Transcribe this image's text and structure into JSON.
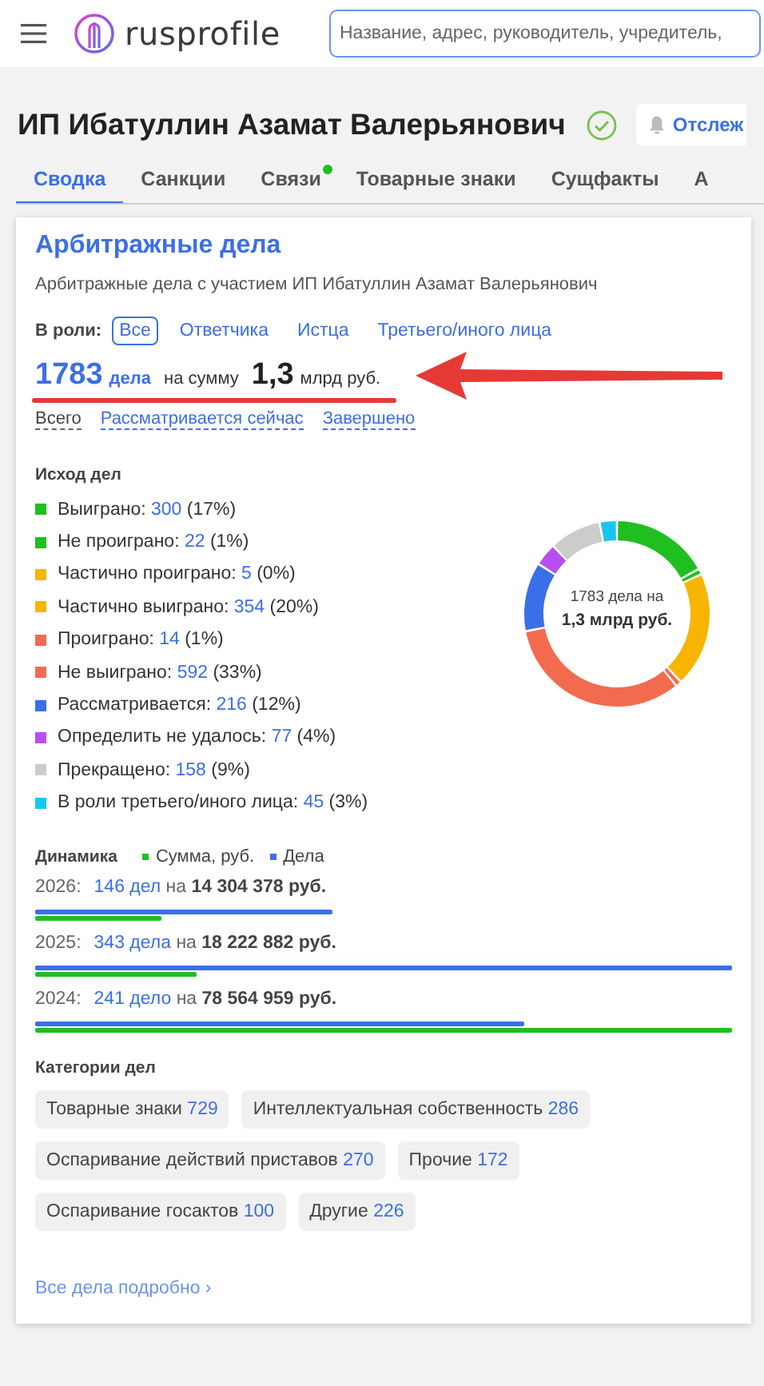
{
  "header": {
    "logo": "rusprofile",
    "search": {
      "placeholder": "Название, адрес, руководитель, учредитель,"
    }
  },
  "company": {
    "title": "ИП Ибатуллин Азамат Валерьянович",
    "verified": true,
    "track_button": "Отслеж"
  },
  "tabs": [
    {
      "label": "Сводка",
      "selected": true,
      "dot": false
    },
    {
      "label": "Санкции",
      "selected": false,
      "dot": false
    },
    {
      "label": "Связи",
      "selected": false,
      "dot": true
    },
    {
      "label": "Товарные знаки",
      "selected": false,
      "dot": false
    },
    {
      "label": "Сущфакты",
      "selected": false,
      "dot": false
    },
    {
      "label": "А",
      "selected": false,
      "dot": false
    }
  ],
  "card": {
    "title": "Арбитражные дела",
    "subtitle": "Арбитражные дела с участием ИП Ибатуллин Азамат Валерьянович",
    "role_label": "В роли:",
    "roles": [
      {
        "label": "Все",
        "selected": true
      },
      {
        "label": "Ответчика",
        "selected": false
      },
      {
        "label": "Истца",
        "selected": false
      },
      {
        "label": "Третьего/иного лица",
        "selected": false
      }
    ],
    "totals": {
      "count": "1783",
      "count_unit": "дела",
      "middle": "на сумму",
      "sum": "1,3",
      "sum_unit": "млрд руб.",
      "highlighted": true
    },
    "status_filters": [
      {
        "label": "Всего",
        "selected": true
      },
      {
        "label": "Рассматривается сейчас",
        "selected": false
      },
      {
        "label": "Завершено",
        "selected": false
      }
    ],
    "outcomes_title": "Исход дел",
    "outcomes": [
      {
        "label": "Выиграно:",
        "count": "300",
        "share": "(17%)",
        "color": "#1fbf1f"
      },
      {
        "label": "Не проиграно:",
        "count": "22",
        "share": "(1%)",
        "color": "#1fbf1f"
      },
      {
        "label": "Частично проиграно:",
        "count": "5",
        "share": "(0%)",
        "color": "#f7b500"
      },
      {
        "label": "Частично выиграно:",
        "count": "354",
        "share": "(20%)",
        "color": "#f7b500"
      },
      {
        "label": "Проиграно:",
        "count": "14",
        "share": "(1%)",
        "color": "#f26b4f"
      },
      {
        "label": "Не выиграно:",
        "count": "592",
        "share": "(33%)",
        "color": "#f26b4f"
      },
      {
        "label": "Рассматривается:",
        "count": "216",
        "share": "(12%)",
        "color": "#3b6fe8"
      },
      {
        "label": "Определить не удалось:",
        "count": "77",
        "share": "(4%)",
        "color": "#b84ef0"
      },
      {
        "label": "Прекращено:",
        "count": "158",
        "share": "(9%)",
        "color": "#cccccc"
      },
      {
        "label": "В роли третьего/иного лица:",
        "count": "45",
        "share": "(3%)",
        "color": "#17c6f0"
      }
    ],
    "donut": {
      "center_line1": "1783 дела на",
      "center_line2": "1,3 млрд руб.",
      "chart_data": {
        "type": "donut",
        "values": [
          17,
          1,
          0,
          20,
          1,
          33,
          12,
          4,
          9,
          3
        ]
      }
    },
    "dynamics_title": "Динамика",
    "dynamics_legend": [
      {
        "label": "Сумма, руб.",
        "color": "#1fbf1f"
      },
      {
        "label": "Дела",
        "color": "#3b6fe8"
      }
    ],
    "dynamics": [
      {
        "year": "2026:",
        "cases": "146 дел",
        "on": "на",
        "sum": "14 304 378 руб."
      },
      {
        "year": "2025:",
        "cases": "343 дела",
        "on": "на",
        "sum": "18 222 882 руб."
      },
      {
        "year": "2024:",
        "cases": "241 дело",
        "on": "на",
        "sum": "78 564 959 руб."
      }
    ],
    "categories_title": "Категории дел",
    "categories": [
      {
        "label": "Товарные знаки",
        "count": "729"
      },
      {
        "label": "Интеллектуальная собственность",
        "count": "286"
      },
      {
        "label": "Оспаривание действий приставов",
        "count": "270"
      },
      {
        "label": "Прочие",
        "count": "172"
      },
      {
        "label": "Оспаривание госактов",
        "count": "100"
      },
      {
        "label": "Другие",
        "count": "226"
      }
    ],
    "more_link": "Все дела подробно",
    "more_arrow": "›"
  }
}
